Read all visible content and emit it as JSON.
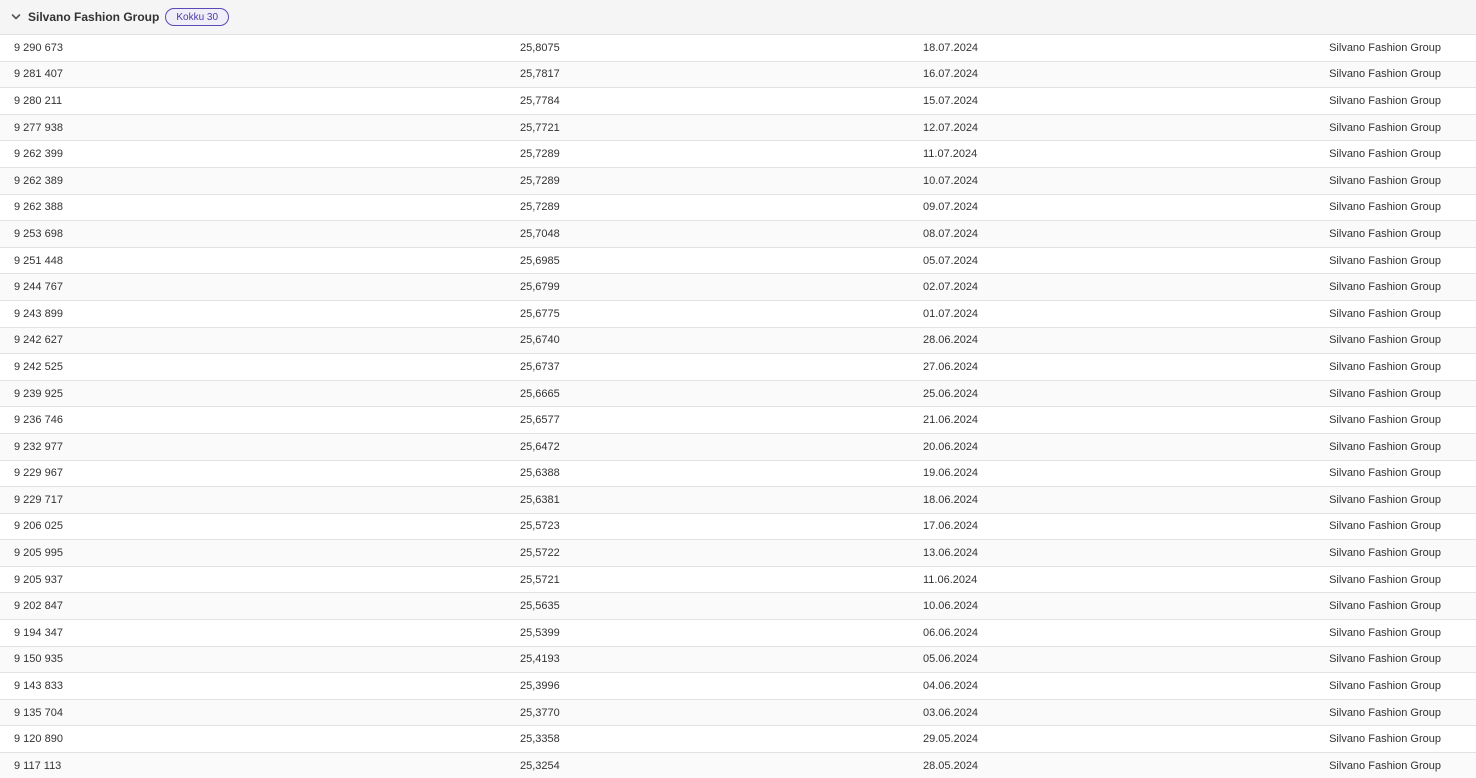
{
  "group": {
    "title": "Silvano Fashion Group",
    "badge": "Kokku 30",
    "icon": "chevron-down-icon"
  },
  "rows": [
    [
      "9 290 673",
      "25,8075",
      "18.07.2024",
      "Silvano Fashion Group"
    ],
    [
      "9 281 407",
      "25,7817",
      "16.07.2024",
      "Silvano Fashion Group"
    ],
    [
      "9 280 211",
      "25,7784",
      "15.07.2024",
      "Silvano Fashion Group"
    ],
    [
      "9 277 938",
      "25,7721",
      "12.07.2024",
      "Silvano Fashion Group"
    ],
    [
      "9 262 399",
      "25,7289",
      "11.07.2024",
      "Silvano Fashion Group"
    ],
    [
      "9 262 389",
      "25,7289",
      "10.07.2024",
      "Silvano Fashion Group"
    ],
    [
      "9 262 388",
      "25,7289",
      "09.07.2024",
      "Silvano Fashion Group"
    ],
    [
      "9 253 698",
      "25,7048",
      "08.07.2024",
      "Silvano Fashion Group"
    ],
    [
      "9 251 448",
      "25,6985",
      "05.07.2024",
      "Silvano Fashion Group"
    ],
    [
      "9 244 767",
      "25,6799",
      "02.07.2024",
      "Silvano Fashion Group"
    ],
    [
      "9 243 899",
      "25,6775",
      "01.07.2024",
      "Silvano Fashion Group"
    ],
    [
      "9 242 627",
      "25,6740",
      "28.06.2024",
      "Silvano Fashion Group"
    ],
    [
      "9 242 525",
      "25,6737",
      "27.06.2024",
      "Silvano Fashion Group"
    ],
    [
      "9 239 925",
      "25,6665",
      "25.06.2024",
      "Silvano Fashion Group"
    ],
    [
      "9 236 746",
      "25,6577",
      "21.06.2024",
      "Silvano Fashion Group"
    ],
    [
      "9 232 977",
      "25,6472",
      "20.06.2024",
      "Silvano Fashion Group"
    ],
    [
      "9 229 967",
      "25,6388",
      "19.06.2024",
      "Silvano Fashion Group"
    ],
    [
      "9 229 717",
      "25,6381",
      "18.06.2024",
      "Silvano Fashion Group"
    ],
    [
      "9 206 025",
      "25,5723",
      "17.06.2024",
      "Silvano Fashion Group"
    ],
    [
      "9 205 995",
      "25,5722",
      "13.06.2024",
      "Silvano Fashion Group"
    ],
    [
      "9 205 937",
      "25,5721",
      "11.06.2024",
      "Silvano Fashion Group"
    ],
    [
      "9 202 847",
      "25,5635",
      "10.06.2024",
      "Silvano Fashion Group"
    ],
    [
      "9 194 347",
      "25,5399",
      "06.06.2024",
      "Silvano Fashion Group"
    ],
    [
      "9 150 935",
      "25,4193",
      "05.06.2024",
      "Silvano Fashion Group"
    ],
    [
      "9 143 833",
      "25,3996",
      "04.06.2024",
      "Silvano Fashion Group"
    ],
    [
      "9 135 704",
      "25,3770",
      "03.06.2024",
      "Silvano Fashion Group"
    ],
    [
      "9 120 890",
      "25,3358",
      "29.05.2024",
      "Silvano Fashion Group"
    ],
    [
      "9 117 113",
      "25,3254",
      "28.05.2024",
      "Silvano Fashion Group"
    ]
  ]
}
